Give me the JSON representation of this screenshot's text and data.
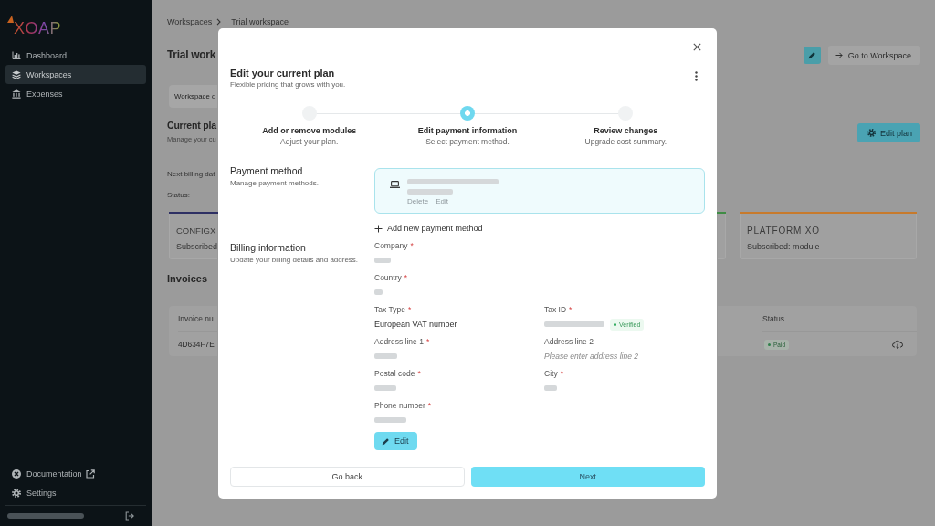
{
  "sidebar": {
    "logo": "XOAP",
    "items": [
      {
        "label": "Dashboard",
        "selected": false
      },
      {
        "label": "Workspaces",
        "selected": true
      },
      {
        "label": "Expenses",
        "selected": false
      }
    ],
    "footer_items": [
      {
        "label": "Documentation",
        "external": true
      },
      {
        "label": "Settings",
        "external": false
      }
    ],
    "user": {
      "redacted": true
    }
  },
  "breadcrumb": [
    "Workspaces",
    "Trial workspace"
  ],
  "header": {
    "title": "Trial work",
    "buttons": [
      {
        "kind": "icon"
      },
      {
        "kind": "link",
        "label": "Go to Workspace"
      }
    ]
  },
  "tabs": [
    {
      "label": "Workspace d",
      "selected": true
    }
  ],
  "current_plan": {
    "title": "Current pla",
    "subtitle": "Manage your cu",
    "button": "Edit plan",
    "next_billing": "Next billing dat",
    "status": "Status:"
  },
  "modules": [
    {
      "logo": "CONFIGX",
      "status": "Subscribed",
      "color": "#2d2f63"
    },
    {
      "color": "#3f8c45"
    },
    {
      "logo": "PLATFORM XO",
      "status": "Subscribed: module",
      "color": "#c77a2c"
    }
  ],
  "invoices": {
    "title": "Invoices",
    "columns": [
      "Invoice nu",
      "Status"
    ],
    "rows": [
      {
        "number": "4D634F7E",
        "status": "Paid"
      }
    ]
  },
  "dialog": {
    "title": "Edit your current plan",
    "subtitle": "Flexible pricing that grows with you.",
    "steps": [
      {
        "title": "Add or remove modules",
        "subtitle": "Adjust your plan.",
        "selected": false
      },
      {
        "title": "Edit payment information",
        "subtitle": "Select payment method.",
        "selected": true
      },
      {
        "title": "Review changes",
        "subtitle": "Upgrade cost summary.",
        "selected": false
      }
    ],
    "payment": {
      "title": "Payment method",
      "subtitle": "Manage payment methods.",
      "methods": [
        {
          "selected": true,
          "redacted": true,
          "actions": [
            "Delete",
            "Edit"
          ]
        }
      ],
      "add_button": "Add new payment method"
    },
    "billing": {
      "title": "Billing information",
      "subtitle": "Update your billing details and address.",
      "rows": [
        [
          {
            "label": "Company",
            "mark": "*",
            "kind": "redacted"
          }
        ],
        [
          {
            "label": "Country",
            "mark": "*",
            "kind": "redacted"
          }
        ],
        [
          {
            "label": "Tax Type",
            "mark": "*",
            "kind": "value",
            "value": "European VAT number"
          },
          {
            "label": "Tax ID",
            "mark": "*",
            "kind": "redacted",
            "badge": "Verified"
          }
        ],
        [
          {
            "label": "Address line 1",
            "mark": "*",
            "kind": "redacted"
          },
          {
            "label": "Address line 2",
            "kind": "placeholder",
            "placeholder": "Please enter address line 2"
          }
        ],
        [
          {
            "label": "Postal code",
            "mark": "*",
            "kind": "redacted"
          },
          {
            "label": "City",
            "mark": "*",
            "kind": "redacted"
          }
        ],
        [
          {
            "label": "Phone number",
            "mark": "*",
            "kind": "redacted"
          }
        ]
      ],
      "edit_button": "Edit"
    },
    "buttons": [
      {
        "kind": "secondary",
        "label": "Go back"
      },
      {
        "kind": "primary",
        "label": "Next"
      }
    ]
  }
}
